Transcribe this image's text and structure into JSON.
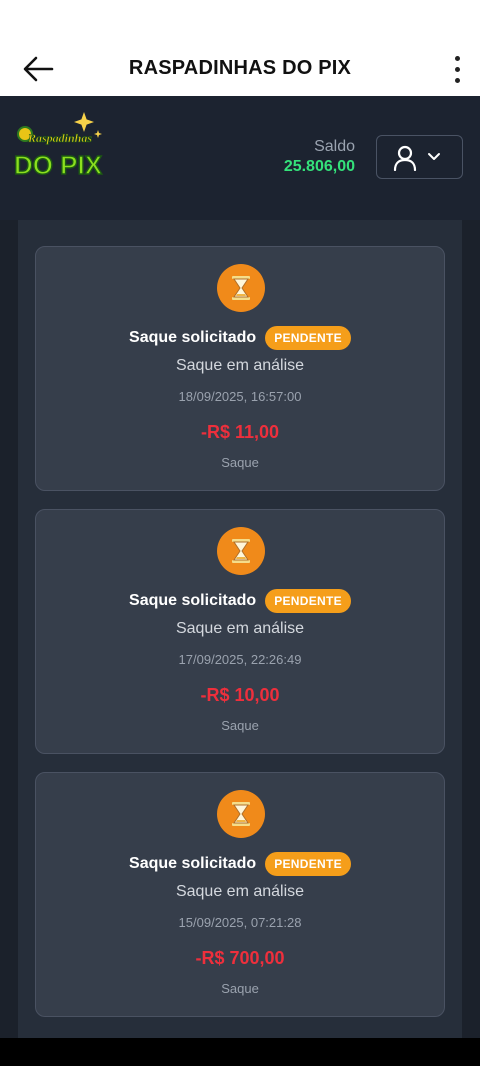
{
  "topbar": {
    "title": "RASPADINHAS DO PIX"
  },
  "header": {
    "logo_top": "Raspadinhas",
    "logo_bottom": "DO PIX",
    "saldo_label": "Saldo",
    "saldo_value": "25.806,00"
  },
  "colors": {
    "accent_orange": "#f08a1a",
    "badge": "#f59e1a",
    "negative": "#ee2f3c",
    "balance": "#34e27a"
  },
  "transactions": [
    {
      "icon": "hourglass-icon",
      "title": "Saque solicitado",
      "status": "PENDENTE",
      "subtitle": "Saque em análise",
      "date": "18/09/2025, 16:57:00",
      "amount": "-R$ 11,00",
      "type": "Saque"
    },
    {
      "icon": "hourglass-icon",
      "title": "Saque solicitado",
      "status": "PENDENTE",
      "subtitle": "Saque em análise",
      "date": "17/09/2025, 22:26:49",
      "amount": "-R$ 10,00",
      "type": "Saque"
    },
    {
      "icon": "hourglass-icon",
      "title": "Saque solicitado",
      "status": "PENDENTE",
      "subtitle": "Saque em análise",
      "date": "15/09/2025, 07:21:28",
      "amount": "-R$ 700,00",
      "type": "Saque"
    }
  ]
}
